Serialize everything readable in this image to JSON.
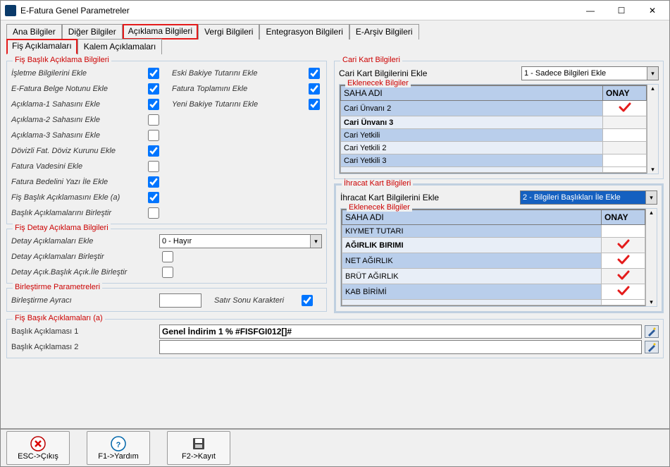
{
  "window": {
    "title": "E-Fatura Genel Parametreler"
  },
  "tabs1": {
    "ana": "Ana Bilgiler",
    "diger": "Diğer Bilgiler",
    "aciklama": "Açıklama Bilgileri",
    "vergi": "Vergi Bilgileri",
    "entegrasyon": "Entegrasyon Bilgileri",
    "earsiv": "E-Arşiv Bilgileri"
  },
  "tabs2": {
    "fis": "Fiş Açıklamaları",
    "kalem": "Kalem Açıklamaları"
  },
  "fis_baslik": {
    "legend": "Fiş Başlık Açıklama Bilgileri",
    "left": [
      {
        "label": "İşletme Bilgilerini Ekle",
        "checked": true
      },
      {
        "label": "E-Fatura Belge Notunu Ekle",
        "checked": true
      },
      {
        "label": "Açıklama-1 Sahasını Ekle",
        "checked": true
      },
      {
        "label": "Açıklama-2 Sahasını Ekle",
        "checked": false
      },
      {
        "label": "Açıklama-3 Sahasını Ekle",
        "checked": false
      },
      {
        "label": "Dövizli Fat. Döviz Kurunu Ekle",
        "checked": true
      },
      {
        "label": "Fatura Vadesini Ekle",
        "checked": false
      },
      {
        "label": "Fatura Bedelini Yazı İle Ekle",
        "checked": true
      },
      {
        "label": "Fiş Başlık Açıklamasını Ekle (a)",
        "checked": true
      },
      {
        "label": "Başlık Açıklamalarını Birleştir",
        "checked": false
      }
    ],
    "right": [
      {
        "label": "Eski Bakiye Tutarını Ekle",
        "checked": true
      },
      {
        "label": "Fatura Toplamını Ekle",
        "checked": true
      },
      {
        "label": "Yeni Bakiye Tutarını Ekle",
        "checked": true
      }
    ]
  },
  "fis_detay": {
    "legend": "Fiş Detay Açıklama Bilgileri",
    "detay_ekle_label": "Detay Açıklamaları Ekle",
    "detay_ekle_value": "0 - Hayır",
    "birlesti_label": "Detay Açıklamaları Birleştir",
    "acik_label": "Detay Açık.Başlık Açık.İle Birleştir"
  },
  "birlestirme": {
    "legend": "Birleştirme Parametreleri",
    "ayrac_label": "Birleştirme Ayracı",
    "satir_label": "Satır Sonu Karakteri"
  },
  "fis_a": {
    "legend": "Fiş Başık Açıklamaları (a)",
    "b1": "Başlık Açıklaması 1",
    "b1_val": "Genel İndirim 1 % #FISFGI012[]#",
    "b2": "Başlık Açıklaması 2",
    "b2_val": ""
  },
  "cari": {
    "legend": "Cari Kart Bilgileri",
    "ekle_label": "Cari Kart Bilgilerini Ekle",
    "ekle_value": "1 - Sadece Bilgileri Ekle",
    "sub_legend": "Eklenecek Bilgiler",
    "header_saha": "SAHA ADI",
    "header_onay": "ONAY",
    "rows": [
      {
        "label": "Cari Ünvanı 2",
        "tick": "red",
        "bold": false
      },
      {
        "label": "Cari Ünvanı 3",
        "tick": "",
        "bold": true
      },
      {
        "label": "Cari Yetkili",
        "tick": "",
        "bold": false
      },
      {
        "label": "Cari Yetkili 2",
        "tick": "",
        "bold": false
      },
      {
        "label": "Cari Yetkili 3",
        "tick": "",
        "bold": false
      }
    ]
  },
  "ihracat": {
    "legend": "İhracat Kart Bilgileri",
    "ekle_label": "İhracat Kart Bilgilerini Ekle",
    "ekle_value": "2 - Bilgileri Başlıkları İle Ekle",
    "sub_legend": "Eklenecek Bilgiler",
    "header_saha": "SAHA ADI",
    "header_onay": "ONAY",
    "rows": [
      {
        "label": "KIYMET TUTARI",
        "tick": "",
        "bold": false
      },
      {
        "label": "AĞIRLIK BIRIMI",
        "tick": "red",
        "bold": true
      },
      {
        "label": "NET AĞIRLIK",
        "tick": "red",
        "bold": false
      },
      {
        "label": "BRÜT AĞIRLIK",
        "tick": "red",
        "bold": false
      },
      {
        "label": "KAB BİRİMİ",
        "tick": "red",
        "bold": false
      }
    ]
  },
  "buttons": {
    "esc": "ESC->Çıkış",
    "f1": "F1->Yardım",
    "f2": "F2->Kayıt"
  }
}
